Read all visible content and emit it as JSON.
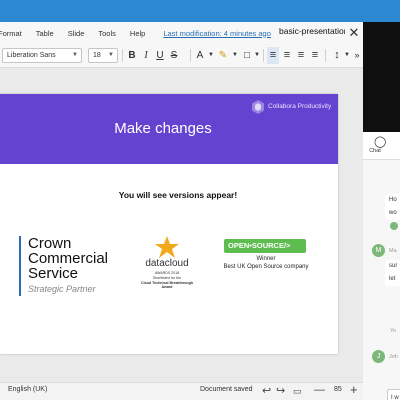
{
  "menu": {
    "items": [
      "Format",
      "Table",
      "Slide",
      "Tools",
      "Help"
    ],
    "last_modification": "Last modification: 4 minutes ago"
  },
  "document": {
    "title": "basic-presentation"
  },
  "toolbar": {
    "font_name": "Liberation Sans",
    "font_size": "18",
    "bold": "B",
    "italic": "I",
    "underline": "U",
    "strikethrough": "S",
    "font_size_glyph": "A"
  },
  "slide": {
    "brand": "Collabora Productivity",
    "title": "Make changes",
    "subtitle": "You will see versions appear!",
    "crown": {
      "lines": [
        "Crown",
        "Commercial",
        "Service"
      ],
      "partner": "Strategic Partner"
    },
    "datacloud": {
      "name": "datacloud",
      "awards": "AWARDS 2018",
      "shortlisted": "Shortlisted for the",
      "award": "Cloud Technical Breakthrough Award"
    },
    "opensource": {
      "badge": "OPEN•SOURCE/>",
      "winner": "Winner",
      "desc": "Best UK Open Source company"
    }
  },
  "statusbar": {
    "language": "English (UK)",
    "doc_status": "Document saved",
    "zoom": "85",
    "zoom_out": "—",
    "zoom_in": "+"
  },
  "chat": {
    "tab_label": "Chat",
    "messages": [
      {
        "lines": [
          "Ho",
          "wo"
        ],
        "avatar": "",
        "meta": ""
      },
      {
        "lines": [
          "sur",
          "let"
        ],
        "avatar": "M",
        "meta": "Ma"
      },
      {
        "lines": [
          "I w"
        ],
        "avatar": "J",
        "meta": "Joh"
      }
    ],
    "timestamp_fragment": "Yo",
    "input_value": "I w"
  },
  "colors": {
    "accent_blue": "#2d88d4",
    "slide_header": "#6443d1",
    "open_source_green": "#5dbd4e",
    "avatar_green": "#7cb87a"
  }
}
